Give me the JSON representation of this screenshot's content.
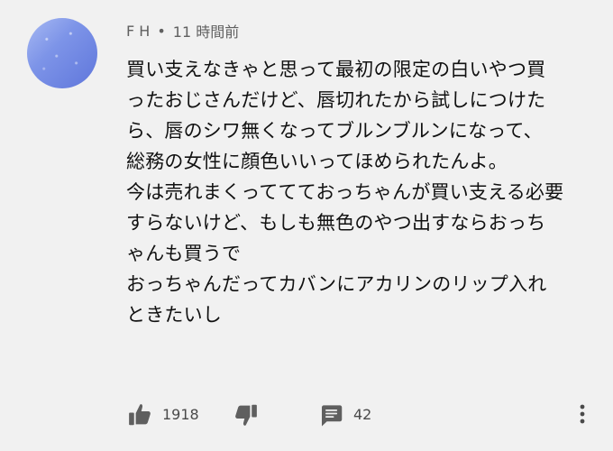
{
  "comment": {
    "author": "F H",
    "separator": "•",
    "time": "11 時間前",
    "lines": [
      "買い支えなきゃと思って最初の限定の白いやつ買",
      "ったおじさんだけど、唇切れたから試しにつけた",
      "ら、唇のシワ無くなってブルンブルンになって、",
      "総務の女性に顔色いいってほめられたんよ。",
      "今は売れまくっててておっちゃんが買い支える必要",
      "すらないけど、もしも無色のやつ出すならおっち",
      "ゃんも買うで",
      "おっちゃんだってカバンにアカリンのリップ入れ",
      "ときたいし"
    ]
  },
  "actions": {
    "like_count": "1918",
    "reply_count": "42"
  },
  "icons": {
    "avatar": "avatar",
    "like": "thumbs-up-icon",
    "dislike": "thumbs-down-icon",
    "reply": "comment-icon",
    "more": "more-vertical-icon"
  }
}
